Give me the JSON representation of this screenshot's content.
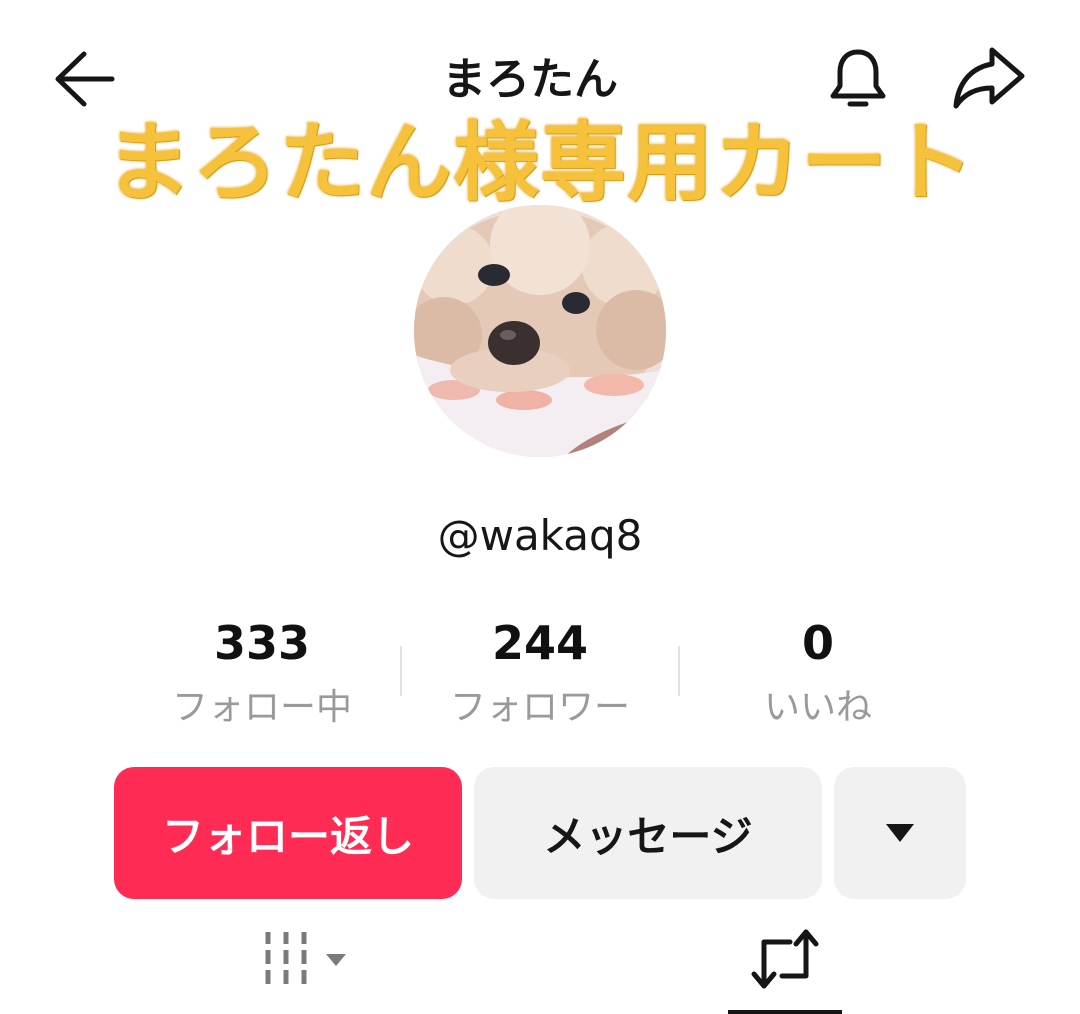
{
  "header": {
    "title": "まろたん",
    "back_icon": "arrow-left-icon",
    "bell_icon": "bell-icon",
    "share_icon": "share-arrow-icon"
  },
  "banner": {
    "text": "まろたん様専用カート",
    "color": "#f6c23c"
  },
  "profile": {
    "avatar_description_icon": "dog-avatar",
    "handle": "@wakaq8"
  },
  "stats": [
    {
      "value": "333",
      "label": "フォロー中"
    },
    {
      "value": "244",
      "label": "フォロワー"
    },
    {
      "value": "0",
      "label": "いいね"
    }
  ],
  "actions": {
    "follow_label": "フォロー返し",
    "message_label": "メッセージ",
    "more_icon": "caret-down-icon",
    "follow_color": "#fe2c55"
  },
  "tabs": {
    "grid_icon": "grid-lines-icon",
    "repost_icon": "repost-icon"
  }
}
